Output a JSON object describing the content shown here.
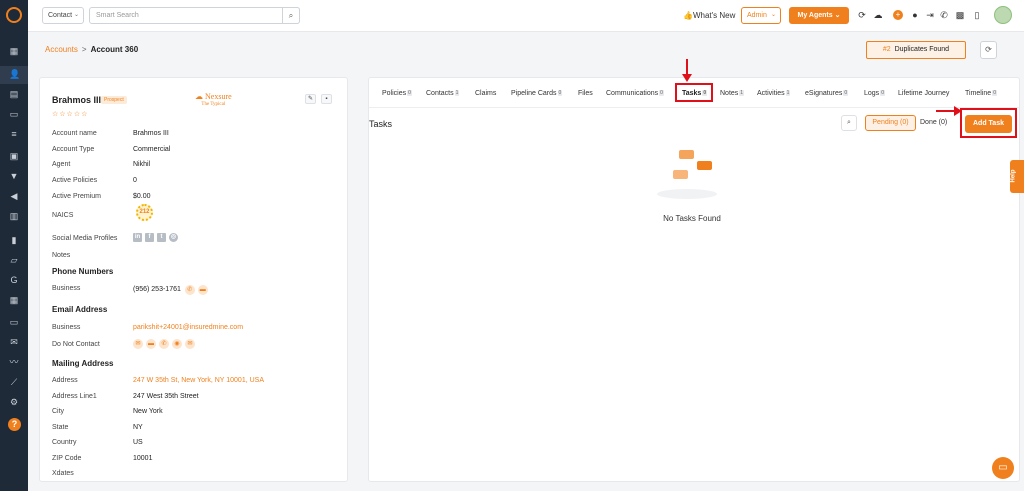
{
  "topbar": {
    "scope_select": "Contact",
    "search_placeholder": "Smart Search",
    "whats_new": "What's New",
    "role_select": "Admin",
    "my_agents": "My Agents"
  },
  "breadcrumb": {
    "parent": "Accounts",
    "separator": ">",
    "current": "Account 360"
  },
  "duplicates": {
    "number": "#2",
    "label": "Duplicates Found"
  },
  "account": {
    "name": "Brahmos III",
    "badge": "Prospect",
    "brand_name": "Nexsure",
    "brand_tagline": "The Typical",
    "naics_code": "212",
    "fields": [
      {
        "label": "Account name",
        "value": "Brahmos III"
      },
      {
        "label": "Account Type",
        "value": "Commercial"
      },
      {
        "label": "Agent",
        "value": "Nikhil"
      },
      {
        "label": "Active Policies",
        "value": "0"
      },
      {
        "label": "Active Premium",
        "value": "$0.00"
      }
    ],
    "naics_label": "NAICS",
    "social_label": "Social Media Profiles",
    "notes_label": "Notes",
    "phone_section": "Phone Numbers",
    "phone_label": "Business",
    "phone_value": "(956) 253-1761",
    "email_section": "Email Address",
    "email_label": "Business",
    "email_value": "parikshit+24001@insuredmine.com",
    "dnc_label": "Do Not Contact",
    "mailing_section": "Mailing Address",
    "mailing": [
      {
        "label": "Address",
        "value": "247 W 35th St, New York, NY 10001, USA"
      },
      {
        "label": "Address Line1",
        "value": "247 West 35th Street"
      },
      {
        "label": "City",
        "value": "New York"
      },
      {
        "label": "State",
        "value": "NY"
      },
      {
        "label": "Country",
        "value": "US"
      },
      {
        "label": "ZIP Code",
        "value": "10001"
      },
      {
        "label": "Xdates",
        "value": ""
      }
    ]
  },
  "tabs": [
    {
      "label": "Policies",
      "count": "0"
    },
    {
      "label": "Contacts",
      "count": "1"
    },
    {
      "label": "Claims",
      "count": ""
    },
    {
      "label": "Pipeline Cards",
      "count": "0"
    },
    {
      "label": "Files",
      "count": ""
    },
    {
      "label": "Communications",
      "count": "0"
    },
    {
      "label": "Tasks",
      "count": "0"
    },
    {
      "label": "Notes",
      "count": "1"
    },
    {
      "label": "Activities",
      "count": "1"
    },
    {
      "label": "eSignatures",
      "count": "0"
    },
    {
      "label": "Logs",
      "count": "0"
    },
    {
      "label": "Lifetime Journey",
      "count": ""
    },
    {
      "label": "Timeline",
      "count": "0"
    }
  ],
  "tasks": {
    "title": "Tasks",
    "pending": "Pending (0)",
    "done": "Done (0)",
    "add_button": "Add Task",
    "empty_text": "No Tasks Found"
  },
  "help_tab": "Help",
  "colors": {
    "accent": "#f0801d",
    "sidebar": "#1e2a38",
    "highlight": "#e0101a"
  }
}
